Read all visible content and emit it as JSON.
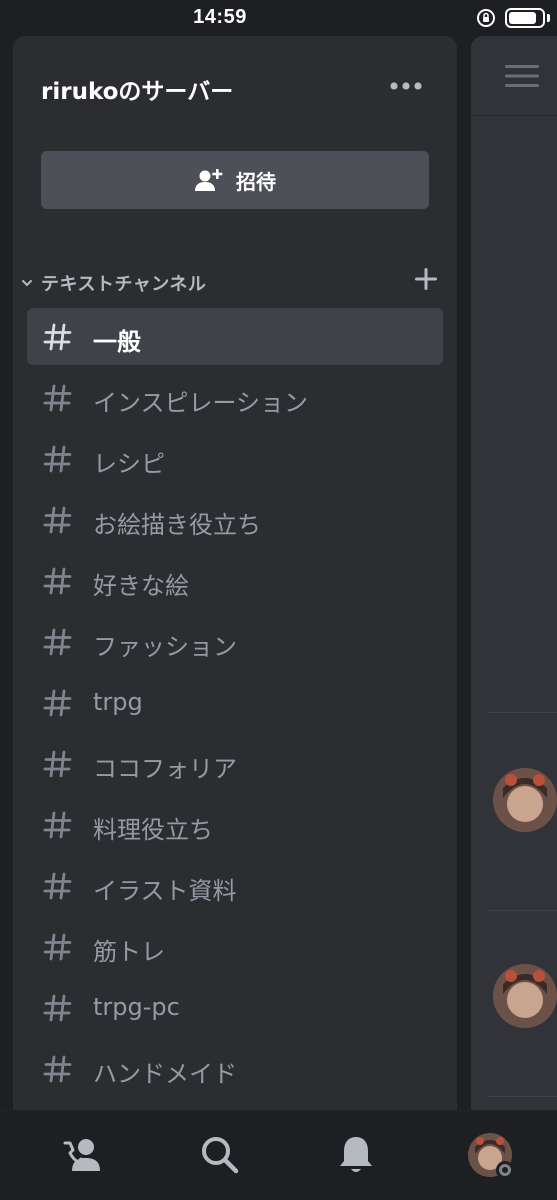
{
  "status_bar": {
    "time": "14:59",
    "battery_level": 0.85,
    "icons": [
      "orientation-lock-icon",
      "battery-icon"
    ]
  },
  "server": {
    "name": "rirukoのサーバー",
    "more_icon": "ellipsis-icon"
  },
  "invite": {
    "label": "招待",
    "icon": "add-person-icon"
  },
  "category": {
    "label": "テキストチャンネル",
    "expanded": true
  },
  "channels": [
    {
      "name": "一般",
      "selected": true
    },
    {
      "name": "インスピレーション",
      "selected": false
    },
    {
      "name": "レシピ",
      "selected": false
    },
    {
      "name": "お絵描き役立ち",
      "selected": false
    },
    {
      "name": "好きな絵",
      "selected": false
    },
    {
      "name": "ファッション",
      "selected": false
    },
    {
      "name": "trpg",
      "selected": false
    },
    {
      "name": "ココフォリア",
      "selected": false
    },
    {
      "name": "料理役立ち",
      "selected": false
    },
    {
      "name": "イラスト資料",
      "selected": false
    },
    {
      "name": "筋トレ",
      "selected": false
    },
    {
      "name": "trpg-pc",
      "selected": false
    },
    {
      "name": "ハンドメイド",
      "selected": false
    }
  ],
  "bottom_nav": {
    "items": [
      "friends-icon",
      "search-icon",
      "notifications-bell-icon",
      "profile-avatar"
    ]
  },
  "colors": {
    "background": "#1e1f22",
    "panel": "#2b2d31",
    "chat": "#313338",
    "selected": "#404249",
    "button": "#4e5058",
    "muted_text": "#949ba4",
    "category_text": "#b5bac1"
  }
}
